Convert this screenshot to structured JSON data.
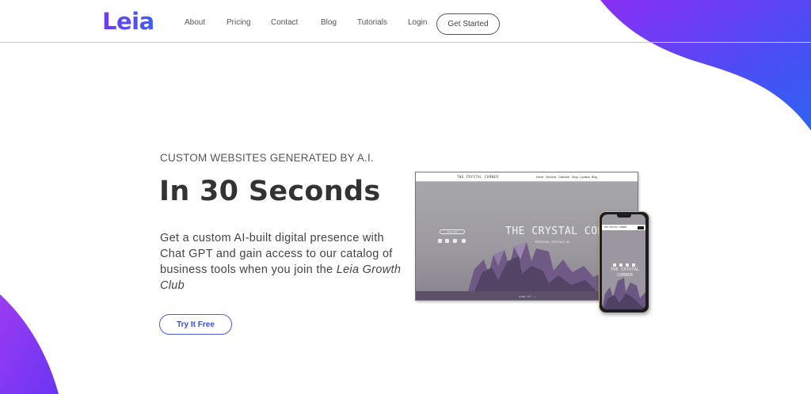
{
  "brand": {
    "name": "Leia"
  },
  "nav": {
    "links": [
      "About",
      "Pricing",
      "Contact",
      "Blog",
      "Tutorials",
      "Login"
    ],
    "cta_label": "Get Started"
  },
  "hero": {
    "eyebrow": "CUSTOM WEBSITES GENERATED BY A.I.",
    "headline": "In 30 Seconds",
    "description_prefix": "Get a custom AI-built digital presence with Chat GPT and gain access to our catalog of business tools when you join the ",
    "description_emphasis": "Leia Growth Club",
    "cta_label": "Try It Free"
  },
  "mockup_desktop": {
    "site_brand": "THE CRYSTAL CORNER",
    "menu": [
      "Home",
      "Services",
      "Calendar",
      "Shop",
      "Location",
      "Blog"
    ],
    "hero_title": "THE CRYSTAL COR",
    "hero_subtitle": "SPIRITUAL CRYSTALS HE",
    "pill_label": "Shop Now",
    "footer_text": "view all →"
  },
  "mockup_phone": {
    "bar_text": "THE CRYSTAL CORNER",
    "hero_title": "THE CRYSTAL CORNER"
  },
  "colors": {
    "accent": "#4a5ce8",
    "gradient_start": "#7b2ff7",
    "gradient_end": "#2f5bf5"
  }
}
